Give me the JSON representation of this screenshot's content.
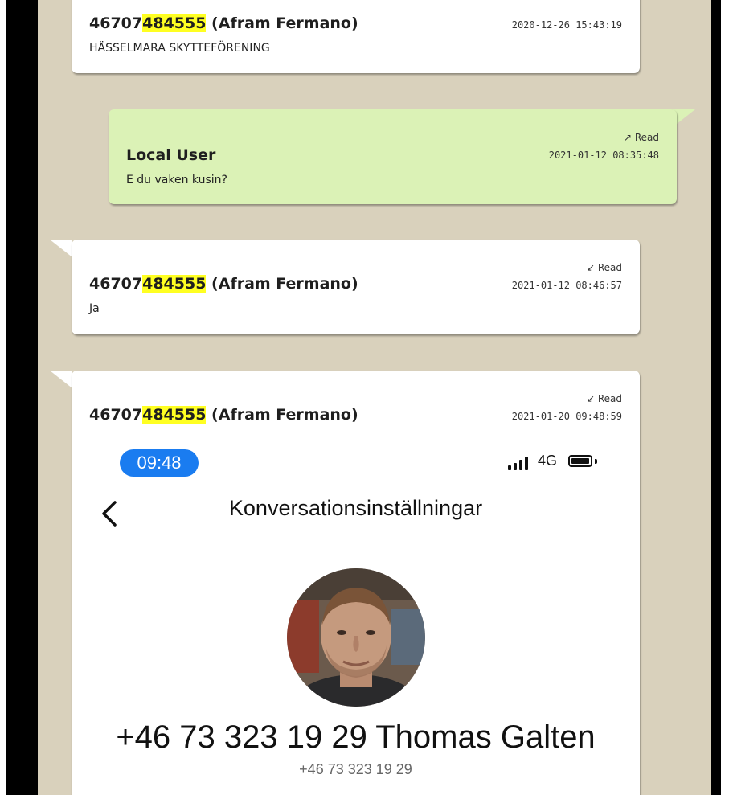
{
  "messages": [
    {
      "sender_prefix": "46707",
      "sender_highlight": "484555",
      "sender_suffix": " (Afram Fermano)",
      "timestamp": "2020-12-26 15:43:19",
      "text": "HÄSSELMARA SKYTTEFÖRENING",
      "status": "",
      "direction": "incoming"
    },
    {
      "sender": "Local User",
      "timestamp": "2021-01-12 08:35:48",
      "text": "E du vaken kusin?",
      "status": "↗ Read",
      "direction": "outgoing"
    },
    {
      "sender_prefix": "46707",
      "sender_highlight": "484555",
      "sender_suffix": " (Afram Fermano)",
      "timestamp": "2021-01-12 08:46:57",
      "text": "Ja",
      "status": "↙ Read",
      "direction": "incoming"
    },
    {
      "sender_prefix": "46707",
      "sender_highlight": "484555",
      "sender_suffix": " (Afram Fermano)",
      "timestamp": "2021-01-20 09:48:59",
      "status": "↙ Read",
      "direction": "incoming",
      "attachment": {
        "clock": "09:48",
        "network": "4G",
        "screen_title": "Konversationsinställningar",
        "contact_name": "+46 73 323 19 29 Thomas Galten",
        "contact_number": "+46 73 323 19 29"
      }
    }
  ],
  "colors": {
    "chat_background": "#d9d1bc",
    "outgoing_bubble": "#dbf2b6",
    "incoming_bubble": "#ffffff",
    "highlight": "#ffff22",
    "time_pill": "#1a7cf0"
  }
}
